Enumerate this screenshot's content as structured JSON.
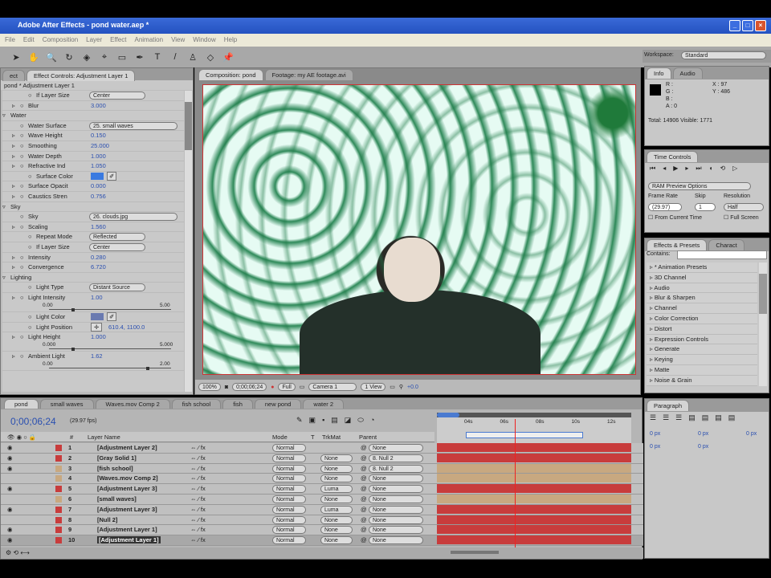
{
  "window": {
    "title": "Adobe After Effects - pond water.aep *"
  },
  "menu": [
    "File",
    "Edit",
    "Composition",
    "Layer",
    "Effect",
    "Animation",
    "View",
    "Window",
    "Help"
  ],
  "toolbar_icons": [
    "selection-icon",
    "hand-icon",
    "zoom-icon",
    "rotate-icon",
    "orbit-camera-icon",
    "track-xy-icon",
    "rectangle-mask-icon",
    "pen-icon",
    "text-icon",
    "brush-icon",
    "clone-stamp-icon",
    "eraser-icon",
    "puppet-pin-icon"
  ],
  "workspace": {
    "label": "Workspace:",
    "value": "Standard"
  },
  "effect_controls": {
    "tab_partial": "ect",
    "tab": "Effect Controls: Adjustment Layer 1",
    "subtitle": "pond * Adjustment Layer 1",
    "rows": [
      {
        "label": "If Layer Size",
        "value": "Center",
        "type": "dropdown",
        "indent": 3
      },
      {
        "label": "Blur",
        "value": "3.000",
        "type": "value",
        "indent": 2
      },
      {
        "label": "Water",
        "type": "group",
        "indent": 1
      },
      {
        "label": "Water Surface",
        "value": "25. small waves",
        "type": "dropdown",
        "indent": 2
      },
      {
        "label": "Wave Height",
        "value": "0.150",
        "type": "value",
        "indent": 2
      },
      {
        "label": "Smoothing",
        "value": "25.000",
        "type": "value",
        "indent": 2
      },
      {
        "label": "Water Depth",
        "value": "1.000",
        "type": "value",
        "indent": 2
      },
      {
        "label": "Refractive Ind",
        "value": "1.050",
        "type": "value",
        "indent": 2
      },
      {
        "label": "Surface Color",
        "type": "color",
        "indent": 3
      },
      {
        "label": "Surface Opacit",
        "value": "0.000",
        "type": "value",
        "indent": 2
      },
      {
        "label": "Caustics Stren",
        "value": "0.756",
        "type": "value",
        "indent": 2
      },
      {
        "label": "Sky",
        "type": "group",
        "indent": 1
      },
      {
        "label": "Sky",
        "value": "26. clouds.jpg",
        "type": "dropdown",
        "indent": 2
      },
      {
        "label": "Scaling",
        "value": "1.560",
        "type": "value",
        "indent": 2
      },
      {
        "label": "Repeat Mode",
        "value": "Reflected",
        "type": "dropdown",
        "indent": 3
      },
      {
        "label": "If Layer Size",
        "value": "Center",
        "type": "dropdown",
        "indent": 3
      },
      {
        "label": "Intensity",
        "value": "0.280",
        "type": "value",
        "indent": 2
      },
      {
        "label": "Convergence",
        "value": "6.720",
        "type": "value",
        "indent": 2
      },
      {
        "label": "Lighting",
        "type": "group",
        "indent": 1
      },
      {
        "label": "Light Type",
        "value": "Distant Source",
        "type": "dropdown",
        "indent": 3
      },
      {
        "label": "Light Intensity",
        "value": "1.00",
        "type": "value",
        "indent": 2,
        "slider": {
          "min": "0.00",
          "max": "5.00",
          "frac": 0.2
        }
      },
      {
        "label": "Light Color",
        "type": "color",
        "indent": 3
      },
      {
        "label": "Light Position",
        "value": "610.4, 1100.0",
        "type": "point",
        "indent": 3
      },
      {
        "label": "Light Height",
        "value": "1.000",
        "type": "value",
        "indent": 2,
        "slider": {
          "min": "0.000",
          "max": "5.000",
          "frac": 0.2
        }
      },
      {
        "label": "Ambient Light",
        "value": "1.62",
        "type": "value",
        "indent": 2,
        "slider": {
          "min": "0.00",
          "max": "2.00",
          "frac": 0.81
        }
      }
    ]
  },
  "composition": {
    "tab": "Composition: pond",
    "footage_tab": "Footage: my AE footage.avi",
    "footer": {
      "zoom": "100%",
      "timecode": "0;00;06;24",
      "resolution": "Full",
      "camera": "Camera 1",
      "views": "1 View",
      "exposure": "+0.0"
    }
  },
  "info": {
    "tabs": [
      "Info",
      "Audio"
    ],
    "r": "R :",
    "g": "G :",
    "b": "B :",
    "a": "A : 0",
    "x": "X : 97",
    "y": "Y : 486",
    "status": "Total: 14906  Visible: 1771"
  },
  "time_controls": {
    "tab": "Time Controls",
    "preview": "RAM Preview Options",
    "frame_rate_label": "Frame Rate",
    "frame_rate": "(29.97)",
    "skip_label": "Skip",
    "skip": "1",
    "resolution_label": "Resolution",
    "resolution": "Half",
    "from_current": "From Current Time",
    "full_screen": "Full Screen"
  },
  "effects_presets": {
    "tabs": [
      "Effects & Presets",
      "Charact"
    ],
    "contains_label": "Contains:",
    "items": [
      "* Animation Presets",
      "3D Channel",
      "Audio",
      "Blur & Sharpen",
      "Channel",
      "Color Correction",
      "Distort",
      "Expression Controls",
      "Generate",
      "Keying",
      "Matte",
      "Noise & Grain"
    ]
  },
  "paragraph": {
    "tab": "Paragraph",
    "fields": [
      "0 px",
      "0 px",
      "0 px",
      "0 px",
      "0 px"
    ]
  },
  "timeline": {
    "tabs": [
      "pond",
      "small waves",
      "Waves.mov Comp 2",
      "fish school",
      "fish",
      "new pond",
      "water 2"
    ],
    "timecode": "0;00;06;24",
    "fps": "(29.97 fps)",
    "headers": {
      "num": "#",
      "name": "Layer Name",
      "mode": "Mode",
      "t": "T",
      "trkmat": "TrkMat",
      "parent": "Parent"
    },
    "ruler": [
      "04s",
      "06s",
      "08s",
      "10s",
      "12s"
    ],
    "playhead_fraction": 0.44,
    "layers": [
      {
        "n": "1",
        "name": "[Adjustment Layer 2]",
        "label": "#c83c3c",
        "mode": "Normal",
        "trkmat": "",
        "parent": "None",
        "visible": true
      },
      {
        "n": "2",
        "name": "[Gray Solid 1]",
        "label": "#c83c3c",
        "mode": "Normal",
        "trkmat": "None",
        "parent": "8. Null 2",
        "visible": true
      },
      {
        "n": "3",
        "name": "[fish school]",
        "label": "#c8a880",
        "mode": "Normal",
        "trkmat": "None",
        "parent": "8. Null 2",
        "visible": true
      },
      {
        "n": "4",
        "name": "[Waves.mov Comp 2]",
        "label": "#c8a880",
        "mode": "Normal",
        "trkmat": "None",
        "parent": "None",
        "visible": false
      },
      {
        "n": "5",
        "name": "[Adjustment Layer 3]",
        "label": "#c83c3c",
        "mode": "Normal",
        "trkmat": "Luma",
        "parent": "None",
        "visible": true
      },
      {
        "n": "6",
        "name": "[small waves]",
        "label": "#c8a880",
        "mode": "Normal",
        "trkmat": "None",
        "parent": "None",
        "visible": false
      },
      {
        "n": "7",
        "name": "[Adjustment Layer 3]",
        "label": "#c83c3c",
        "mode": "Normal",
        "trkmat": "Luma",
        "parent": "None",
        "visible": true
      },
      {
        "n": "8",
        "name": "[Null 2]",
        "label": "#c83c3c",
        "mode": "Normal",
        "trkmat": "None",
        "parent": "None",
        "visible": false
      },
      {
        "n": "9",
        "name": "[Adjustment Layer 1]",
        "label": "#c83c3c",
        "mode": "Normal",
        "trkmat": "None",
        "parent": "None",
        "visible": true
      },
      {
        "n": "10",
        "name": "[Adjustment Layer 1]",
        "label": "#c83c3c",
        "mode": "Normal",
        "trkmat": "None",
        "parent": "None",
        "visible": true
      }
    ]
  }
}
